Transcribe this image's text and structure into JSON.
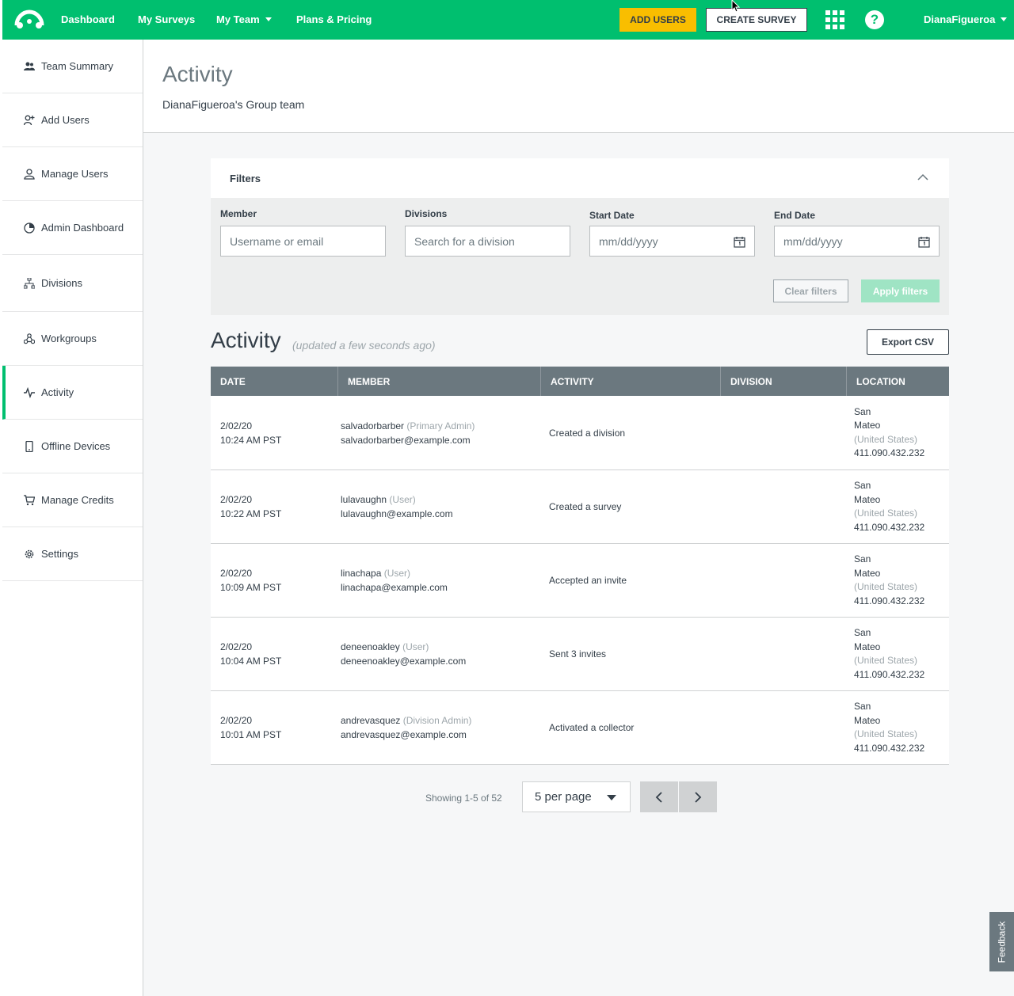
{
  "topnav": {
    "links": [
      "Dashboard",
      "My Surveys",
      "My Team",
      "Plans & Pricing"
    ],
    "add_users": "ADD USERS",
    "create_survey": "CREATE SURVEY",
    "help": "?",
    "username": "DianaFigueroa",
    "brand_color": "#00bf6f"
  },
  "sidebar": {
    "items": [
      {
        "label": "Team Summary",
        "icon": "team-icon"
      },
      {
        "label": "Add Users",
        "icon": "add-user-icon"
      },
      {
        "label": "Manage Users",
        "icon": "user-icon"
      },
      {
        "label": "Admin Dashboard",
        "icon": "dashboard-icon"
      },
      {
        "label": "Divisions",
        "icon": "divisions-icon"
      },
      {
        "label": "Workgroups",
        "icon": "workgroups-icon"
      },
      {
        "label": "Activity",
        "icon": "activity-icon",
        "active": true
      },
      {
        "label": "Offline Devices",
        "icon": "device-icon"
      },
      {
        "label": "Manage Credits",
        "icon": "cart-icon"
      },
      {
        "label": "Settings",
        "icon": "gear-icon"
      }
    ]
  },
  "header": {
    "title": "Activity",
    "subtitle": "DianaFigueroa's Group team"
  },
  "filters": {
    "title": "Filters",
    "member_label": "Member",
    "member_placeholder": "Username or email",
    "divisions_label": "Divisions",
    "divisions_placeholder": "Search for a division",
    "start_label": "Start Date",
    "start_placeholder": "mm/dd/yyyy",
    "end_label": "End Date",
    "end_placeholder": "mm/dd/yyyy",
    "clear": "Clear filters",
    "apply": "Apply filters"
  },
  "activity": {
    "title": "Activity",
    "updated": "(updated a few seconds ago)",
    "export": "Export CSV",
    "columns": [
      "DATE",
      "MEMBER",
      "ACTIVITY",
      "DIVISION",
      "LOCATION"
    ],
    "rows": [
      {
        "date": "2/02/20",
        "time": "10:24 AM PST",
        "user": "salvadorbarber",
        "role": "(Primary Admin)",
        "email": "salvadorbarber@example.com",
        "activity": "Created a division",
        "division": "",
        "city1": "San",
        "city2": "Mateo",
        "country": "(United States)",
        "ip": "411.090.432.232"
      },
      {
        "date": "2/02/20",
        "time": "10:22 AM PST",
        "user": "lulavaughn",
        "role": "(User)",
        "email": "lulavaughn@example.com",
        "activity": "Created a survey",
        "division": "",
        "city1": "San",
        "city2": "Mateo",
        "country": "(United States)",
        "ip": "411.090.432.232"
      },
      {
        "date": "2/02/20",
        "time": "10:09 AM PST",
        "user": "linachapa",
        "role": "(User)",
        "email": "linachapa@example.com",
        "activity": "Accepted an invite",
        "division": "",
        "city1": "San",
        "city2": "Mateo",
        "country": "(United States)",
        "ip": "411.090.432.232"
      },
      {
        "date": "2/02/20",
        "time": "10:04 AM PST",
        "user": "deneenoakley",
        "role": "(User)",
        "email": "deneenoakley@example.com",
        "activity": "Sent 3 invites",
        "division": "",
        "city1": "San",
        "city2": "Mateo",
        "country": "(United States)",
        "ip": "411.090.432.232"
      },
      {
        "date": "2/02/20",
        "time": "10:01 AM PST",
        "user": "andrevasquez",
        "role": "(Division Admin)",
        "email": "andrevasquez@example.com",
        "activity": "Activated a collector",
        "division": "",
        "city1": "San",
        "city2": "Mateo",
        "country": "(United States)",
        "ip": "411.090.432.232"
      }
    ]
  },
  "pagination": {
    "showing": "Showing 1-5 of 52",
    "per_page": "5 per page"
  },
  "feedback": "Feedback"
}
